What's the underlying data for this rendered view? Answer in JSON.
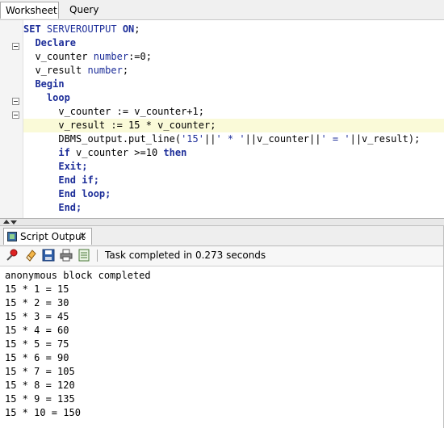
{
  "tabs": {
    "worksheet": "Worksheet",
    "query_builder": "Query Builder"
  },
  "editor": {
    "lines": [
      {
        "parts": [
          {
            "t": "SET ",
            "c": "kw"
          },
          {
            "t": "SERVEROUTPUT ",
            "c": "cl"
          },
          {
            "t": "ON",
            "c": "kw"
          },
          {
            "t": ";",
            "c": ""
          }
        ]
      },
      {
        "parts": [
          {
            "t": "  Declare",
            "c": "pk"
          }
        ]
      },
      {
        "parts": [
          {
            "t": "  v_counter ",
            "c": ""
          },
          {
            "t": "number",
            "c": "cl"
          },
          {
            "t": ":=0;",
            "c": ""
          }
        ]
      },
      {
        "parts": [
          {
            "t": "  v_result ",
            "c": ""
          },
          {
            "t": "number",
            "c": "cl"
          },
          {
            "t": ";",
            "c": ""
          }
        ]
      },
      {
        "parts": [
          {
            "t": "  Begin",
            "c": "pk"
          }
        ]
      },
      {
        "parts": [
          {
            "t": "    loop",
            "c": "pk"
          }
        ]
      },
      {
        "parts": [
          {
            "t": "      v_counter := v_counter+1;",
            "c": ""
          }
        ]
      },
      {
        "parts": [
          {
            "t": "      v_result := 15 * v_counter;",
            "c": ""
          }
        ]
      },
      {
        "parts": [
          {
            "t": "      DBMS_output.put_line(",
            "c": ""
          },
          {
            "t": "'15'",
            "c": "str"
          },
          {
            "t": "||",
            "c": ""
          },
          {
            "t": "' * '",
            "c": "str"
          },
          {
            "t": "||v_counter||",
            "c": ""
          },
          {
            "t": "' = '",
            "c": "str"
          },
          {
            "t": "||v_result);",
            "c": ""
          }
        ]
      },
      {
        "parts": [
          {
            "t": "      ",
            "c": ""
          },
          {
            "t": "if",
            "c": "pk"
          },
          {
            "t": " v_counter >=10 ",
            "c": ""
          },
          {
            "t": "then",
            "c": "pk"
          }
        ]
      },
      {
        "parts": [
          {
            "t": "      ",
            "c": ""
          },
          {
            "t": "Exit;",
            "c": "pk"
          }
        ]
      },
      {
        "parts": [
          {
            "t": "      ",
            "c": ""
          },
          {
            "t": "End if;",
            "c": "pk"
          }
        ]
      },
      {
        "parts": [
          {
            "t": "      ",
            "c": ""
          },
          {
            "t": "End loop;",
            "c": "pk"
          }
        ]
      },
      {
        "parts": [
          {
            "t": "      ",
            "c": ""
          },
          {
            "t": "End;",
            "c": "pk"
          }
        ]
      }
    ],
    "highlighted_line": 7
  },
  "output_panel": {
    "tab_label": "Script Output",
    "close_glyph": "×",
    "task_status": "Task completed in 0.273 seconds",
    "lines": [
      "anonymous block completed",
      "15 * 1 = 15",
      "15 * 2 = 30",
      "15 * 3 = 45",
      "15 * 4 = 60",
      "15 * 5 = 75",
      "15 * 6 = 90",
      "15 * 7 = 105",
      "15 * 8 = 120",
      "15 * 9 = 135",
      "15 * 10 = 150"
    ]
  },
  "toolbar_icons": [
    "pin-icon",
    "eraser-icon",
    "save-icon",
    "print-icon",
    "export-icon"
  ]
}
